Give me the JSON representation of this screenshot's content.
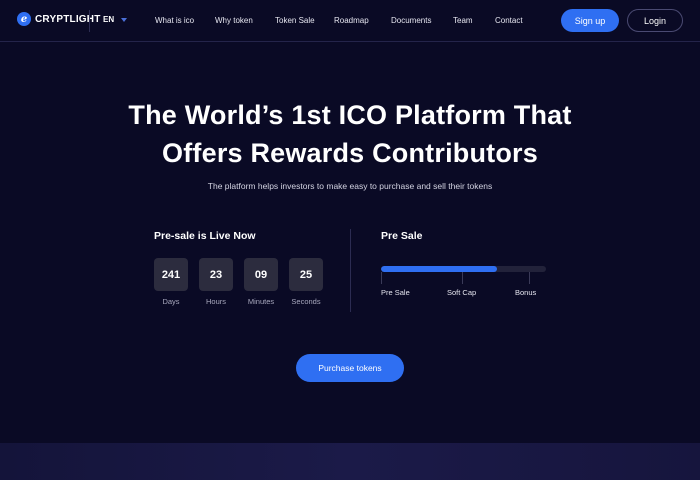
{
  "brand": {
    "logo_glyph": "e",
    "name": "CRYPTLIGHT"
  },
  "language": {
    "selected": "EN"
  },
  "nav": {
    "items": [
      {
        "label": "What is ico"
      },
      {
        "label": "Why token"
      },
      {
        "label": "Token Sale"
      },
      {
        "label": "Roadmap"
      },
      {
        "label": "Documents"
      },
      {
        "label": "Team"
      },
      {
        "label": "Contact"
      }
    ]
  },
  "auth": {
    "signup_label": "Sign up",
    "login_label": "Login"
  },
  "hero": {
    "title_line1": "The World’s 1st ICO Platform That",
    "title_line2": "Offers Rewards Contributors",
    "subtitle": "The platform helps investors to make easy to purchase and sell their tokens"
  },
  "countdown": {
    "title": "Pre-sale is Live Now",
    "units": [
      {
        "value": "241",
        "label": "Days"
      },
      {
        "value": "23",
        "label": "Hours"
      },
      {
        "value": "09",
        "label": "Minutes"
      },
      {
        "value": "25",
        "label": "Seconds"
      }
    ]
  },
  "presale": {
    "title": "Pre Sale",
    "progress_percent": 70,
    "milestones": [
      {
        "label": "Pre Sale"
      },
      {
        "label": "Soft Cap"
      },
      {
        "label": "Bonus"
      }
    ]
  },
  "cta": {
    "purchase_label": "Purchase tokens"
  },
  "colors": {
    "background": "#0a0a25",
    "accent": "#2f6ff2",
    "countdown_box": "#2c2c3e",
    "muted_text": "#a8a8bd"
  },
  "icons": {
    "logo": "crypto-logo-icon",
    "caret": "chevron-down-icon"
  }
}
